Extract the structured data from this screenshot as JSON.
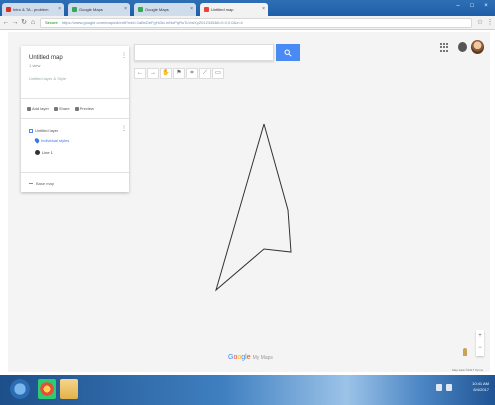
{
  "browser": {
    "tabs": [
      {
        "label": "Intro & TA - problem",
        "fav_color": "#d93025",
        "active": false
      },
      {
        "label": "Google Maps",
        "fav_color": "#34a853",
        "active": false
      },
      {
        "label": "Google Maps",
        "fav_color": "#34a853",
        "active": false
      },
      {
        "label": "Untitled map",
        "fav_color": "#ea4335",
        "active": true
      }
    ],
    "secure_label": "Secure",
    "url": "https://www.google.com/maps/d/edit?mid=1aBcDeFgHiJkLmNoPqRsTuVwXyZ012345&ll=0.0,0.0&z=4"
  },
  "map": {
    "search": {
      "placeholder": "",
      "value": ""
    },
    "tools": [
      "←",
      "→",
      "✋",
      "⚑",
      "⌗",
      "⟋",
      "▭"
    ],
    "shape_color": "#333333"
  },
  "panel": {
    "title": "Untitled map",
    "views": "1 view",
    "description": "Untitled layer & Style",
    "actions": [
      "Add layer",
      "Share",
      "Preview"
    ],
    "layer_name": "Untitled layer",
    "style_link": "Individual styles",
    "item_label": "Line 1",
    "basemap_label": "Base map"
  },
  "footer": {
    "logo_text": [
      "G",
      "o",
      "o",
      "g",
      "l",
      "e"
    ],
    "logo_suffix": "My Maps",
    "terms": "Map data ©2017 Terms"
  },
  "taskbar": {
    "time": "10:41 AM",
    "date": "8/4/2017"
  }
}
